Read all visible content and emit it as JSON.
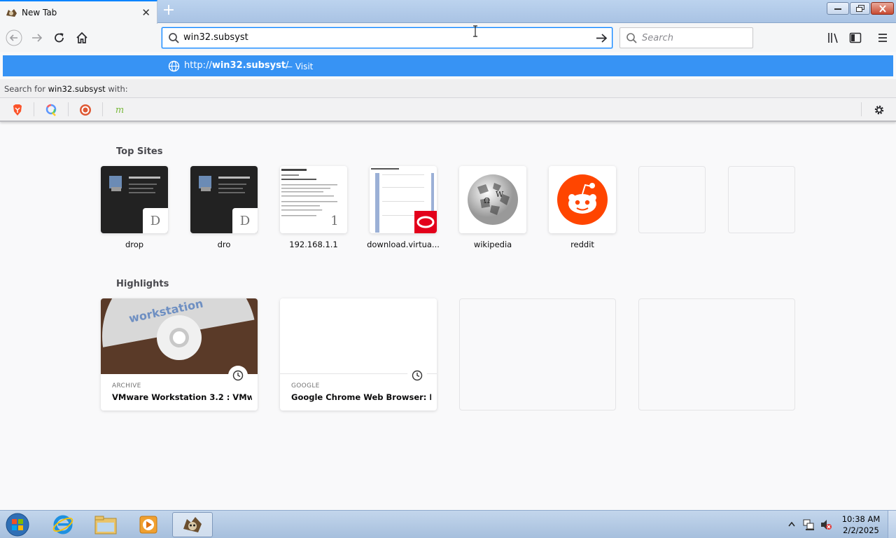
{
  "window": {
    "tab_title": "New Tab",
    "new_tab_symbol": "+",
    "controls": [
      "minimize-icon",
      "restore-icon",
      "close-icon"
    ]
  },
  "toolbar": {
    "url_value": "win32.subsyst",
    "search_placeholder": "Search",
    "icons": [
      "back-icon",
      "forward-icon",
      "reload-icon",
      "home-icon",
      "library-icon",
      "sidebar-icon",
      "menu-icon"
    ]
  },
  "suggestion": {
    "url_prefix": "http://",
    "url_host": "win32.subsyst",
    "url_suffix": "/",
    "visit_label": "— Visit"
  },
  "search_with": {
    "prefix": "Search for ",
    "term": "win32.subsyst",
    "suffix": " with:",
    "engines": [
      "brave-icon",
      "qwant-icon",
      "duckduckgo-icon",
      "mojeek-icon"
    ],
    "mojeek_glyph": "m"
  },
  "top_sites": {
    "title": "Top Sites",
    "items": [
      {
        "label": "drop",
        "badge": "D"
      },
      {
        "label": "dro",
        "badge": "D"
      },
      {
        "label": "192.168.1.1",
        "badge": "1"
      },
      {
        "label": "download.virtua..."
      },
      {
        "label": "wikipedia"
      },
      {
        "label": "reddit"
      }
    ]
  },
  "highlights": {
    "title": "Highlights",
    "items": [
      {
        "source": "ARCHIVE",
        "title": "VMware Workstation 3.2 : VMw..."
      },
      {
        "source": "GOOGLE",
        "title": "Google Chrome Web Browser: Fi..."
      }
    ]
  },
  "taskbar": {
    "items": [
      "start-orb-icon",
      "internet-explorer-icon",
      "file-explorer-icon",
      "media-player-icon",
      "firefox-icon"
    ],
    "time": "10:38 AM",
    "date": "2/2/2025"
  }
}
